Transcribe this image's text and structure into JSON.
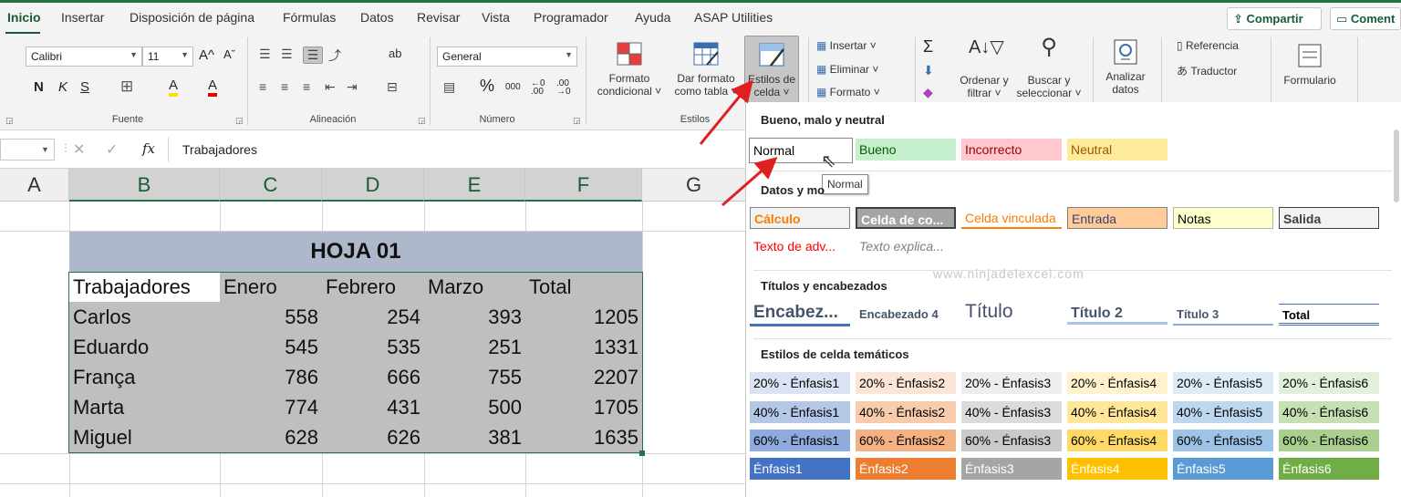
{
  "tabs": [
    "Inicio",
    "Insertar",
    "Disposición de página",
    "Fórmulas",
    "Datos",
    "Revisar",
    "Vista",
    "Programador",
    "Ayuda",
    "ASAP Utilities"
  ],
  "top_buttons": {
    "share": "Compartir",
    "comment": "Coment"
  },
  "ribbon": {
    "font": {
      "name": "Calibri",
      "size": "11",
      "grow": "A^",
      "shrink": "Aˇ",
      "bold": "N",
      "italic": "K",
      "underline": "S",
      "border": "⊞",
      "fill": "A",
      "color": "A",
      "group": "Fuente"
    },
    "align": {
      "wrap": "ab",
      "group": "Alineación"
    },
    "number": {
      "format": "General",
      "percent": "%",
      "thousands": "000",
      "dec_add": "←0 .00",
      "dec_remove": ".00 →0",
      "group": "Número"
    },
    "styles": {
      "cond": [
        "Formato",
        "condicional ˅"
      ],
      "table": [
        "Dar formato",
        "como tabla ˅"
      ],
      "cell": [
        "Estilos de",
        "celda ˅"
      ],
      "group": "Estilos"
    },
    "cells": {
      "insert": "Insertar",
      "delete": "Eliminar",
      "format": "Formato"
    },
    "edit": {
      "sigma": "Σ",
      "sort": [
        "Ordenar y",
        "filtrar ˅"
      ],
      "find": [
        "Buscar y",
        "seleccionar ˅"
      ]
    },
    "analyze": [
      "Analizar",
      "datos"
    ],
    "reference": "Referencia",
    "translator": "Traductor",
    "form": "Formulario"
  },
  "formula_bar": {
    "fx": "fx",
    "value": "Trabajadores"
  },
  "grid": {
    "columns": [
      "A",
      "B",
      "C",
      "D",
      "E",
      "F",
      "G"
    ],
    "title": "HOJA 01",
    "headers": [
      "Trabajadores",
      "Enero",
      "Febrero",
      "Marzo",
      "Total"
    ],
    "rows": [
      [
        "Carlos",
        "558",
        "254",
        "393",
        "1205"
      ],
      [
        "Eduardo",
        "545",
        "535",
        "251",
        "1331"
      ],
      [
        "França",
        "786",
        "666",
        "755",
        "2207"
      ],
      [
        "Marta",
        "774",
        "431",
        "500",
        "1705"
      ],
      [
        "Miguel",
        "628",
        "626",
        "381",
        "1635"
      ]
    ]
  },
  "styles_panel": {
    "sec_good": "Bueno, malo y neutral",
    "good": [
      "Normal",
      "Bueno",
      "Incorrecto",
      "Neutral"
    ],
    "tooltip": "Normal",
    "sec_data": "Datos y mo",
    "data": [
      "Cálculo",
      "Celda de co...",
      "Celda vinculada",
      "Entrada",
      "Notas",
      "Salida",
      "Texto de adv...",
      "Texto explica..."
    ],
    "sec_titles": "Títulos y encabezados",
    "titles": [
      "Encabez...",
      "Encabezado 4",
      "Título",
      "Título 2",
      "Título 3",
      "Total"
    ],
    "sec_theme": "Estilos de celda temáticos",
    "theme": [
      [
        "20% - Énfasis1",
        "20% - Énfasis2",
        "20% - Énfasis3",
        "20% - Énfasis4",
        "20% - Énfasis5",
        "20% - Énfasis6"
      ],
      [
        "40% - Énfasis1",
        "40% - Énfasis2",
        "40% - Énfasis3",
        "40% - Énfasis4",
        "40% - Énfasis5",
        "40% - Énfasis6"
      ],
      [
        "60% - Énfasis1",
        "60% - Énfasis2",
        "60% - Énfasis3",
        "60% - Énfasis4",
        "60% - Énfasis5",
        "60% - Énfasis6"
      ],
      [
        "Énfasis1",
        "Énfasis2",
        "Énfasis3",
        "Énfasis4",
        "Énfasis5",
        "Énfasis6"
      ]
    ],
    "watermark": "www.ninjadelexcel.com"
  },
  "colors": {
    "excel_green": "#217346",
    "table_title_bg": "#adb9ca",
    "table_body_bg": "#bfbfbf",
    "arrow_red": "#e02020"
  }
}
